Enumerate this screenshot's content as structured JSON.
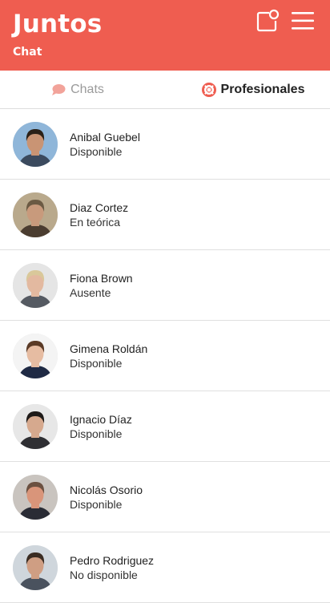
{
  "header": {
    "title": "Juntos",
    "subtitle": "Chat",
    "compose_icon": "new-chat-icon",
    "menu_icon": "hamburger-menu-icon",
    "brand_color": "#ef5d50"
  },
  "tabs": [
    {
      "label": "Chats",
      "icon": "chat-bubble-icon",
      "active": false
    },
    {
      "label": "Profesionales",
      "icon": "lifebuoy-icon",
      "active": true
    }
  ],
  "contacts": [
    {
      "name": "Anibal Guebel",
      "status": "Disponible",
      "bg": "#8fb6d9",
      "hair": "#2b2118",
      "skin": "#c99474",
      "shirt": "#3b4a5e"
    },
    {
      "name": "Diaz Cortez",
      "status": "En teórica",
      "bg": "#b9a98c",
      "hair": "#6b5a43",
      "skin": "#c89a7c",
      "shirt": "#4b3d30"
    },
    {
      "name": "Fiona Brown",
      "status": "Ausente",
      "bg": "#e5e5e5",
      "hair": "#d9c89a",
      "skin": "#e3b9a0",
      "shirt": "#555a62"
    },
    {
      "name": "Gimena Roldán",
      "status": "Disponible",
      "bg": "#f4f4f4",
      "hair": "#5a3a26",
      "skin": "#e6bca2",
      "shirt": "#1f2a44"
    },
    {
      "name": "Ignacio Díaz",
      "status": "Disponible",
      "bg": "#e7e7e7",
      "hair": "#1e1a18",
      "skin": "#d6a98e",
      "shirt": "#2f2f33"
    },
    {
      "name": "Nicolás Osorio",
      "status": "Disponible",
      "bg": "#c9c4bf",
      "hair": "#6b5040",
      "skin": "#d9957a",
      "shirt": "#2a2c35"
    },
    {
      "name": "Pedro Rodriguez",
      "status": "No disponible",
      "bg": "#cfd6dc",
      "hair": "#3a2c22",
      "skin": "#cf9e83",
      "shirt": "#4a525e"
    }
  ]
}
